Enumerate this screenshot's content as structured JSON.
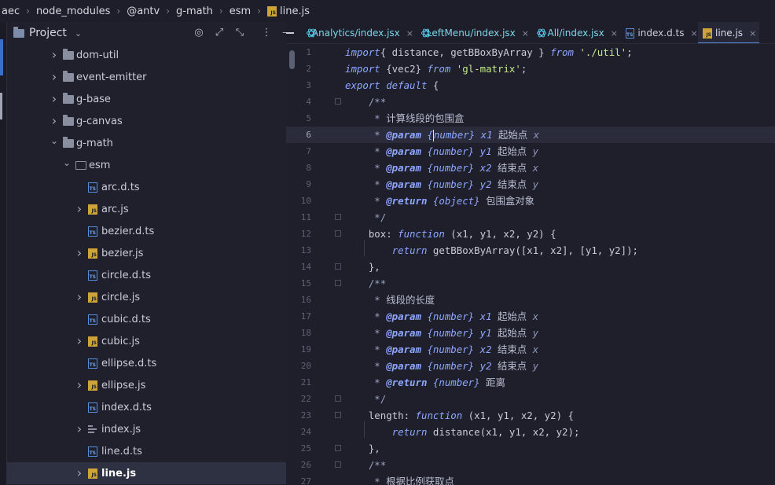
{
  "breadcrumb": {
    "items": [
      "aec",
      "node_modules",
      "@antv",
      "g-math",
      "esm",
      "line.js"
    ],
    "separator": "›"
  },
  "project_panel": {
    "title": "Project",
    "tools": {
      "target": "◎",
      "expand": "⤢",
      "collapse": "⤡",
      "more": "⋮",
      "minimize": "—"
    },
    "tree": [
      {
        "label": "dom-util",
        "kind": "folder",
        "expanded": false,
        "depth": 0
      },
      {
        "label": "event-emitter",
        "kind": "folder",
        "expanded": false,
        "depth": 0
      },
      {
        "label": "g-base",
        "kind": "folder",
        "expanded": false,
        "depth": 0
      },
      {
        "label": "g-canvas",
        "kind": "folder",
        "expanded": false,
        "depth": 0
      },
      {
        "label": "g-math",
        "kind": "folder",
        "expanded": true,
        "depth": 0
      },
      {
        "label": "esm",
        "kind": "folder",
        "expanded": true,
        "depth": 1
      },
      {
        "label": "arc.d.ts",
        "kind": "ts",
        "depth": 2
      },
      {
        "label": "arc.js",
        "kind": "js",
        "depth": 2
      },
      {
        "label": "bezier.d.ts",
        "kind": "ts",
        "depth": 2
      },
      {
        "label": "bezier.js",
        "kind": "js",
        "depth": 2
      },
      {
        "label": "circle.d.ts",
        "kind": "ts",
        "depth": 2
      },
      {
        "label": "circle.js",
        "kind": "js",
        "depth": 2
      },
      {
        "label": "cubic.d.ts",
        "kind": "ts",
        "depth": 2
      },
      {
        "label": "cubic.js",
        "kind": "js",
        "depth": 2
      },
      {
        "label": "ellipse.d.ts",
        "kind": "ts",
        "depth": 2
      },
      {
        "label": "ellipse.js",
        "kind": "js",
        "depth": 2
      },
      {
        "label": "index.d.ts",
        "kind": "ts",
        "depth": 2
      },
      {
        "label": "index.js",
        "kind": "index",
        "depth": 2
      },
      {
        "label": "line.d.ts",
        "kind": "ts",
        "depth": 2
      },
      {
        "label": "line.js",
        "kind": "js",
        "depth": 2,
        "selected": true
      }
    ]
  },
  "tabs": [
    {
      "label": "Analytics/index.jsx",
      "kind": "react"
    },
    {
      "label": "LeftMenu/index.jsx",
      "kind": "react"
    },
    {
      "label": "All/index.jsx",
      "kind": "react"
    },
    {
      "label": "index.d.ts",
      "kind": "ts"
    },
    {
      "label": "line.js",
      "kind": "js",
      "active": true
    }
  ],
  "tab_close_glyph": "×",
  "editor": {
    "current_line": 6,
    "lines": [
      {
        "n": "1",
        "t": [
          [
            "kw",
            "import"
          ],
          [
            "",
            "{ distance, getBBoxByArray } "
          ],
          [
            "kw",
            "from"
          ],
          [
            "",
            " "
          ],
          [
            "str",
            "'./util'"
          ],
          [
            "",
            ";"
          ]
        ]
      },
      {
        "n": "2",
        "t": [
          [
            "kw",
            "import"
          ],
          [
            "",
            " {vec2} "
          ],
          [
            "kw",
            "from"
          ],
          [
            "",
            " "
          ],
          [
            "str",
            "'gl-matrix'"
          ],
          [
            "",
            ";"
          ]
        ]
      },
      {
        "n": "3",
        "t": [
          [
            "kw",
            "export default"
          ],
          [
            "",
            " {"
          ]
        ]
      },
      {
        "n": "4",
        "t": [
          [
            "cm",
            "    /**"
          ]
        ]
      },
      {
        "n": "5",
        "t": [
          [
            "cm",
            "     * "
          ],
          [
            "cjk",
            "计算线段的包围盒"
          ]
        ]
      },
      {
        "n": "6",
        "t": [
          [
            "cm",
            "     * "
          ],
          [
            "doctag",
            "@param"
          ],
          [
            "cm",
            " "
          ],
          [
            "doctype",
            "{"
          ],
          [
            "caret",
            ""
          ],
          [
            "doctype",
            "number}"
          ],
          [
            "cm",
            " "
          ],
          [
            "docname",
            "x1"
          ],
          [
            "cm",
            " "
          ],
          [
            "cjk",
            "起始点"
          ],
          [
            "cm",
            " "
          ],
          [
            "docvar",
            "x"
          ]
        ]
      },
      {
        "n": "7",
        "t": [
          [
            "cm",
            "     * "
          ],
          [
            "doctag",
            "@param"
          ],
          [
            "cm",
            " "
          ],
          [
            "doctype",
            "{number}"
          ],
          [
            "cm",
            " "
          ],
          [
            "docname",
            "y1"
          ],
          [
            "cm",
            " "
          ],
          [
            "cjk",
            "起始点"
          ],
          [
            "cm",
            " "
          ],
          [
            "docvar",
            "y"
          ]
        ]
      },
      {
        "n": "8",
        "t": [
          [
            "cm",
            "     * "
          ],
          [
            "doctag",
            "@param"
          ],
          [
            "cm",
            " "
          ],
          [
            "doctype",
            "{number}"
          ],
          [
            "cm",
            " "
          ],
          [
            "docname",
            "x2"
          ],
          [
            "cm",
            " "
          ],
          [
            "cjk",
            "结束点"
          ],
          [
            "cm",
            " "
          ],
          [
            "docvar",
            "x"
          ]
        ]
      },
      {
        "n": "9",
        "t": [
          [
            "cm",
            "     * "
          ],
          [
            "doctag",
            "@param"
          ],
          [
            "cm",
            " "
          ],
          [
            "doctype",
            "{number}"
          ],
          [
            "cm",
            " "
          ],
          [
            "docname",
            "y2"
          ],
          [
            "cm",
            " "
          ],
          [
            "cjk",
            "结束点"
          ],
          [
            "cm",
            " "
          ],
          [
            "docvar",
            "y"
          ]
        ]
      },
      {
        "n": "10",
        "t": [
          [
            "cm",
            "     * "
          ],
          [
            "doctag",
            "@return"
          ],
          [
            "cm",
            " "
          ],
          [
            "doctype",
            "{object}"
          ],
          [
            "cm",
            " "
          ],
          [
            "cjk",
            "包围盒对象"
          ]
        ]
      },
      {
        "n": "11",
        "t": [
          [
            "cm",
            "     */"
          ]
        ]
      },
      {
        "n": "12",
        "t": [
          [
            "",
            "    box: "
          ],
          [
            "kw",
            "function"
          ],
          [
            "",
            " (x1, y1, x2, y2) {"
          ]
        ]
      },
      {
        "n": "13",
        "t": [
          [
            "",
            "        "
          ],
          [
            "kw",
            "return"
          ],
          [
            "",
            " getBBoxByArray([x1, x2], [y1, y2]);"
          ]
        ]
      },
      {
        "n": "14",
        "t": [
          [
            "",
            "    },"
          ]
        ]
      },
      {
        "n": "15",
        "t": [
          [
            "cm",
            "    /**"
          ]
        ]
      },
      {
        "n": "16",
        "t": [
          [
            "cm",
            "     * "
          ],
          [
            "cjk",
            "线段的长度"
          ]
        ]
      },
      {
        "n": "17",
        "t": [
          [
            "cm",
            "     * "
          ],
          [
            "doctag",
            "@param"
          ],
          [
            "cm",
            " "
          ],
          [
            "doctype",
            "{number}"
          ],
          [
            "cm",
            " "
          ],
          [
            "docname",
            "x1"
          ],
          [
            "cm",
            " "
          ],
          [
            "cjk",
            "起始点"
          ],
          [
            "cm",
            " "
          ],
          [
            "docvar",
            "x"
          ]
        ]
      },
      {
        "n": "18",
        "t": [
          [
            "cm",
            "     * "
          ],
          [
            "doctag",
            "@param"
          ],
          [
            "cm",
            " "
          ],
          [
            "doctype",
            "{number}"
          ],
          [
            "cm",
            " "
          ],
          [
            "docname",
            "y1"
          ],
          [
            "cm",
            " "
          ],
          [
            "cjk",
            "起始点"
          ],
          [
            "cm",
            " "
          ],
          [
            "docvar",
            "y"
          ]
        ]
      },
      {
        "n": "19",
        "t": [
          [
            "cm",
            "     * "
          ],
          [
            "doctag",
            "@param"
          ],
          [
            "cm",
            " "
          ],
          [
            "doctype",
            "{number}"
          ],
          [
            "cm",
            " "
          ],
          [
            "docname",
            "x2"
          ],
          [
            "cm",
            " "
          ],
          [
            "cjk",
            "结束点"
          ],
          [
            "cm",
            " "
          ],
          [
            "docvar",
            "x"
          ]
        ]
      },
      {
        "n": "20",
        "t": [
          [
            "cm",
            "     * "
          ],
          [
            "doctag",
            "@param"
          ],
          [
            "cm",
            " "
          ],
          [
            "doctype",
            "{number}"
          ],
          [
            "cm",
            " "
          ],
          [
            "docname",
            "y2"
          ],
          [
            "cm",
            " "
          ],
          [
            "cjk",
            "结束点"
          ],
          [
            "cm",
            " "
          ],
          [
            "docvar",
            "y"
          ]
        ]
      },
      {
        "n": "21",
        "t": [
          [
            "cm",
            "     * "
          ],
          [
            "doctag",
            "@return"
          ],
          [
            "cm",
            " "
          ],
          [
            "doctype",
            "{number}"
          ],
          [
            "cm",
            " "
          ],
          [
            "cjk",
            "距离"
          ]
        ]
      },
      {
        "n": "22",
        "t": [
          [
            "cm",
            "     */"
          ]
        ]
      },
      {
        "n": "23",
        "t": [
          [
            "",
            "    length: "
          ],
          [
            "kw",
            "function"
          ],
          [
            "",
            " (x1, y1, x2, y2) {"
          ]
        ]
      },
      {
        "n": "24",
        "t": [
          [
            "",
            "        "
          ],
          [
            "kw",
            "return"
          ],
          [
            "",
            " distance(x1, y1, x2, y2);"
          ]
        ]
      },
      {
        "n": "25",
        "t": [
          [
            "",
            "    },"
          ]
        ]
      },
      {
        "n": "26",
        "t": [
          [
            "cm",
            "    /**"
          ]
        ]
      },
      {
        "n": "27",
        "t": [
          [
            "cm",
            "     * "
          ],
          [
            "cjk",
            "根据比例获取点"
          ]
        ]
      }
    ]
  }
}
